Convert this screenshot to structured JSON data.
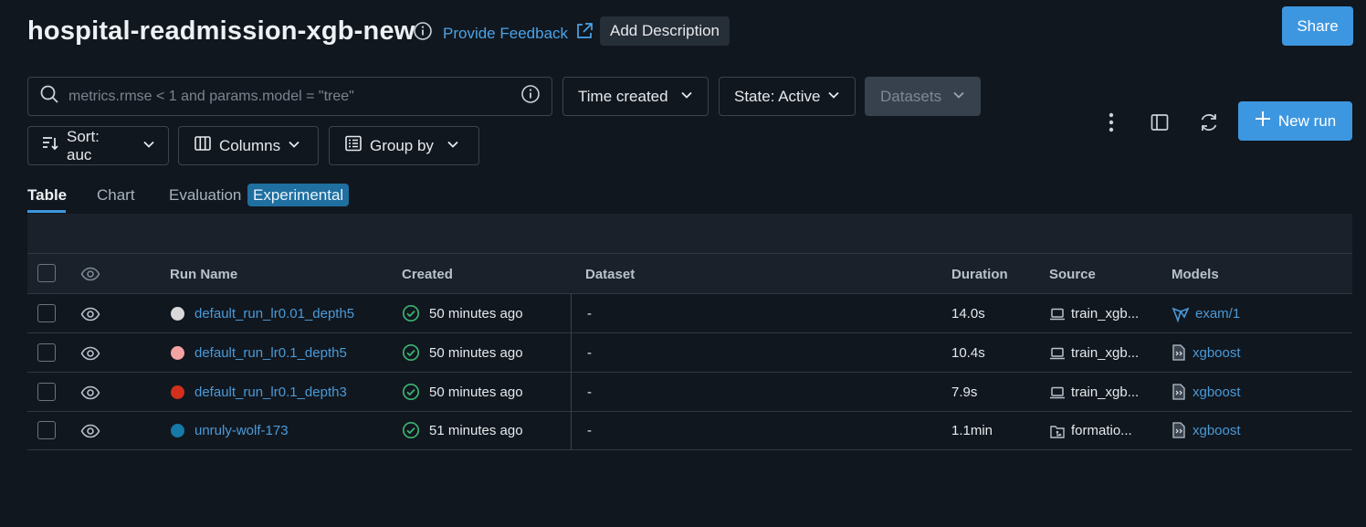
{
  "header": {
    "title": "hospital-readmission-xgb-new",
    "feedback_label": "Provide Feedback",
    "add_description_label": "Add Description",
    "share_label": "Share"
  },
  "filters": {
    "search_placeholder": "metrics.rmse < 1 and params.model = \"tree\"",
    "time_created_label": "Time created",
    "state_label": "State: Active",
    "datasets_label": "Datasets",
    "sort_label": "Sort: auc",
    "columns_label": "Columns",
    "group_by_label": "Group by",
    "new_run_label": "New run"
  },
  "tabs": [
    {
      "label": "Table",
      "active": true
    },
    {
      "label": "Chart",
      "active": false
    },
    {
      "label": "Evaluation",
      "active": false
    }
  ],
  "experimental_badge": "Experimental",
  "table": {
    "columns": [
      "Run Name",
      "Created",
      "Dataset",
      "Duration",
      "Source",
      "Models"
    ],
    "rows": [
      {
        "color": "#d9d9d9",
        "run_name": "default_run_lr0.01_depth5",
        "created": "50 minutes ago",
        "dataset": "-",
        "duration": "14.0s",
        "source": "train_xgb...",
        "source_icon": "laptop-icon",
        "model": "exam/1",
        "model_icon": "registered-model-icon"
      },
      {
        "color": "#f4a3a3",
        "run_name": "default_run_lr0.1_depth5",
        "created": "50 minutes ago",
        "dataset": "-",
        "duration": "10.4s",
        "source": "train_xgb...",
        "source_icon": "laptop-icon",
        "model": "xgboost",
        "model_icon": "model-file-icon"
      },
      {
        "color": "#d42f1c",
        "run_name": "default_run_lr0.1_depth3",
        "created": "50 minutes ago",
        "dataset": "-",
        "duration": "7.9s",
        "source": "train_xgb...",
        "source_icon": "laptop-icon",
        "model": "xgboost",
        "model_icon": "model-file-icon"
      },
      {
        "color": "#157aa8",
        "run_name": "unruly-wolf-173",
        "created": "51 minutes ago",
        "dataset": "-",
        "duration": "1.1min",
        "source": "formatio...",
        "source_icon": "git-folder-icon",
        "model": "xgboost",
        "model_icon": "model-file-icon"
      }
    ]
  },
  "colors": {
    "accent": "#3d97e0",
    "link": "#4a9ad8",
    "success": "#3cb371",
    "background": "#11171f"
  }
}
